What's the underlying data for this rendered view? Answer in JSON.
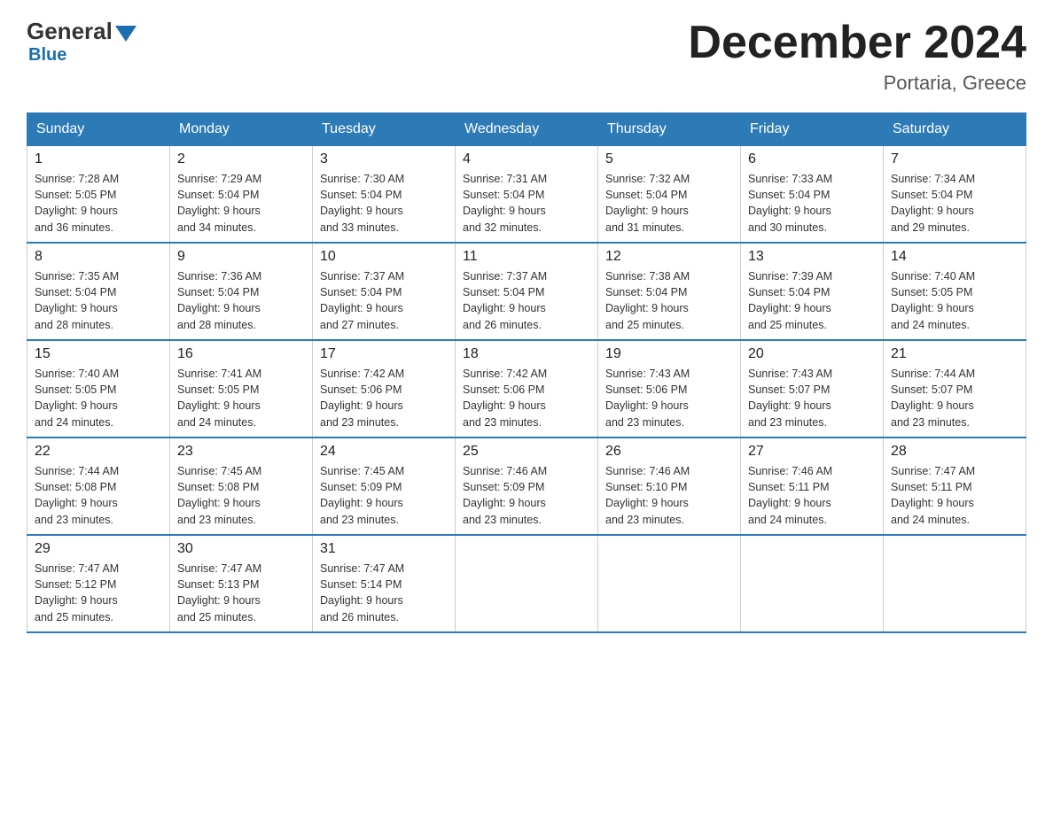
{
  "header": {
    "logo_general": "General",
    "logo_blue": "Blue",
    "month_title": "December 2024",
    "location": "Portaria, Greece"
  },
  "days_of_week": [
    "Sunday",
    "Monday",
    "Tuesday",
    "Wednesday",
    "Thursday",
    "Friday",
    "Saturday"
  ],
  "weeks": [
    [
      {
        "day": "1",
        "sunrise": "7:28 AM",
        "sunset": "5:05 PM",
        "daylight": "9 hours and 36 minutes."
      },
      {
        "day": "2",
        "sunrise": "7:29 AM",
        "sunset": "5:04 PM",
        "daylight": "9 hours and 34 minutes."
      },
      {
        "day": "3",
        "sunrise": "7:30 AM",
        "sunset": "5:04 PM",
        "daylight": "9 hours and 33 minutes."
      },
      {
        "day": "4",
        "sunrise": "7:31 AM",
        "sunset": "5:04 PM",
        "daylight": "9 hours and 32 minutes."
      },
      {
        "day": "5",
        "sunrise": "7:32 AM",
        "sunset": "5:04 PM",
        "daylight": "9 hours and 31 minutes."
      },
      {
        "day": "6",
        "sunrise": "7:33 AM",
        "sunset": "5:04 PM",
        "daylight": "9 hours and 30 minutes."
      },
      {
        "day": "7",
        "sunrise": "7:34 AM",
        "sunset": "5:04 PM",
        "daylight": "9 hours and 29 minutes."
      }
    ],
    [
      {
        "day": "8",
        "sunrise": "7:35 AM",
        "sunset": "5:04 PM",
        "daylight": "9 hours and 28 minutes."
      },
      {
        "day": "9",
        "sunrise": "7:36 AM",
        "sunset": "5:04 PM",
        "daylight": "9 hours and 28 minutes."
      },
      {
        "day": "10",
        "sunrise": "7:37 AM",
        "sunset": "5:04 PM",
        "daylight": "9 hours and 27 minutes."
      },
      {
        "day": "11",
        "sunrise": "7:37 AM",
        "sunset": "5:04 PM",
        "daylight": "9 hours and 26 minutes."
      },
      {
        "day": "12",
        "sunrise": "7:38 AM",
        "sunset": "5:04 PM",
        "daylight": "9 hours and 25 minutes."
      },
      {
        "day": "13",
        "sunrise": "7:39 AM",
        "sunset": "5:04 PM",
        "daylight": "9 hours and 25 minutes."
      },
      {
        "day": "14",
        "sunrise": "7:40 AM",
        "sunset": "5:05 PM",
        "daylight": "9 hours and 24 minutes."
      }
    ],
    [
      {
        "day": "15",
        "sunrise": "7:40 AM",
        "sunset": "5:05 PM",
        "daylight": "9 hours and 24 minutes."
      },
      {
        "day": "16",
        "sunrise": "7:41 AM",
        "sunset": "5:05 PM",
        "daylight": "9 hours and 24 minutes."
      },
      {
        "day": "17",
        "sunrise": "7:42 AM",
        "sunset": "5:06 PM",
        "daylight": "9 hours and 23 minutes."
      },
      {
        "day": "18",
        "sunrise": "7:42 AM",
        "sunset": "5:06 PM",
        "daylight": "9 hours and 23 minutes."
      },
      {
        "day": "19",
        "sunrise": "7:43 AM",
        "sunset": "5:06 PM",
        "daylight": "9 hours and 23 minutes."
      },
      {
        "day": "20",
        "sunrise": "7:43 AM",
        "sunset": "5:07 PM",
        "daylight": "9 hours and 23 minutes."
      },
      {
        "day": "21",
        "sunrise": "7:44 AM",
        "sunset": "5:07 PM",
        "daylight": "9 hours and 23 minutes."
      }
    ],
    [
      {
        "day": "22",
        "sunrise": "7:44 AM",
        "sunset": "5:08 PM",
        "daylight": "9 hours and 23 minutes."
      },
      {
        "day": "23",
        "sunrise": "7:45 AM",
        "sunset": "5:08 PM",
        "daylight": "9 hours and 23 minutes."
      },
      {
        "day": "24",
        "sunrise": "7:45 AM",
        "sunset": "5:09 PM",
        "daylight": "9 hours and 23 minutes."
      },
      {
        "day": "25",
        "sunrise": "7:46 AM",
        "sunset": "5:09 PM",
        "daylight": "9 hours and 23 minutes."
      },
      {
        "day": "26",
        "sunrise": "7:46 AM",
        "sunset": "5:10 PM",
        "daylight": "9 hours and 23 minutes."
      },
      {
        "day": "27",
        "sunrise": "7:46 AM",
        "sunset": "5:11 PM",
        "daylight": "9 hours and 24 minutes."
      },
      {
        "day": "28",
        "sunrise": "7:47 AM",
        "sunset": "5:11 PM",
        "daylight": "9 hours and 24 minutes."
      }
    ],
    [
      {
        "day": "29",
        "sunrise": "7:47 AM",
        "sunset": "5:12 PM",
        "daylight": "9 hours and 25 minutes."
      },
      {
        "day": "30",
        "sunrise": "7:47 AM",
        "sunset": "5:13 PM",
        "daylight": "9 hours and 25 minutes."
      },
      {
        "day": "31",
        "sunrise": "7:47 AM",
        "sunset": "5:14 PM",
        "daylight": "9 hours and 26 minutes."
      },
      null,
      null,
      null,
      null
    ]
  ],
  "labels": {
    "sunrise": "Sunrise:",
    "sunset": "Sunset:",
    "daylight": "Daylight:"
  }
}
